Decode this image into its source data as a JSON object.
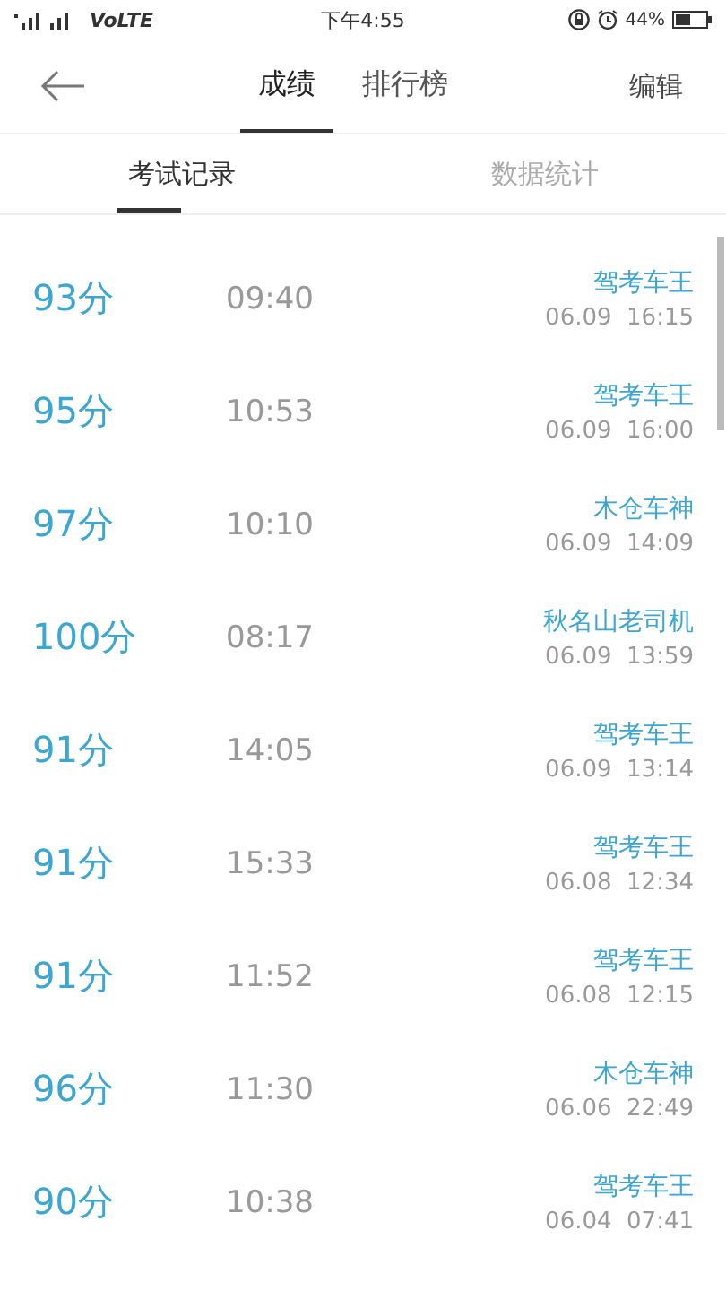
{
  "status_bar": {
    "network": "VoLTE",
    "time": "下午4:55",
    "battery": "44%"
  },
  "header": {
    "tabs": [
      {
        "label": "成绩",
        "selected": true
      },
      {
        "label": "排行榜",
        "selected": false
      }
    ],
    "action": "编辑"
  },
  "subtabs": [
    {
      "label": "考试记录",
      "selected": true
    },
    {
      "label": "数据统计",
      "selected": false
    }
  ],
  "records": [
    {
      "score": "93分",
      "duration": "09:40",
      "title": "驾考车王",
      "date": "06.09  16:15"
    },
    {
      "score": "95分",
      "duration": "10:53",
      "title": "驾考车王",
      "date": "06.09  16:00"
    },
    {
      "score": "97分",
      "duration": "10:10",
      "title": "木仓车神",
      "date": "06.09  14:09"
    },
    {
      "score": "100分",
      "duration": "08:17",
      "title": "秋名山老司机",
      "date": "06.09  13:59"
    },
    {
      "score": "91分",
      "duration": "14:05",
      "title": "驾考车王",
      "date": "06.09  13:14"
    },
    {
      "score": "91分",
      "duration": "15:33",
      "title": "驾考车王",
      "date": "06.08  12:34"
    },
    {
      "score": "91分",
      "duration": "11:52",
      "title": "驾考车王",
      "date": "06.08  12:15"
    },
    {
      "score": "96分",
      "duration": "11:30",
      "title": "木仓车神",
      "date": "06.06  22:49"
    },
    {
      "score": "90分",
      "duration": "10:38",
      "title": "驾考车王",
      "date": "06.04  07:41"
    }
  ]
}
